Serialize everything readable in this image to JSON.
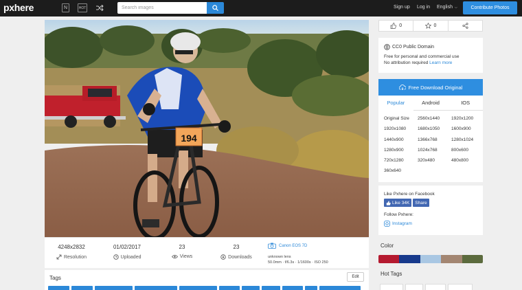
{
  "header": {
    "logo": "pxhere",
    "icon_new": "N",
    "icon_hot": "HOT",
    "search_placeholder": "Search images",
    "signup": "Sign up",
    "login": "Log in",
    "language": "English",
    "contribute": "Contribute Photos"
  },
  "stats": {
    "resolution_value": "4248x2832",
    "resolution_label": "Resolution",
    "uploaded_value": "01/02/2017",
    "uploaded_label": "Uploaded",
    "views_value": "23",
    "views_label": "Views",
    "downloads_value": "23",
    "downloads_label": "Downloads",
    "camera": "Canon EOS 7D",
    "lens": "unknown lens",
    "exif": "50.0mm · f/6.3s · 1/1600s · ISO 250"
  },
  "tags": {
    "title": "Tags",
    "edit": "Edit"
  },
  "sidebar": {
    "likes": "0",
    "favorites": "0",
    "license_title": "CC0 Public Domain",
    "license_line1": "Free for personal and commercial use",
    "license_line2": "No attribution required",
    "learn_more": "Learn more",
    "download_button": "Free Download Original",
    "tabs": [
      "Popular",
      "Android",
      "IOS"
    ],
    "sizes": [
      "Original Size",
      "2560x1440",
      "1920x1200",
      "1920x1080",
      "1680x1050",
      "1600x900",
      "1440x900",
      "1366x768",
      "1280x1024",
      "1280x900",
      "1024x768",
      "800x600",
      "720x1280",
      "320x480",
      "480x800",
      "360x640"
    ],
    "facebook_title": "Like Pxhere on Facebook",
    "fb_like": "Like 34K",
    "fb_share": "Share",
    "follow": "Follow Pxhere:",
    "instagram": "Instagram",
    "color_title": "Color",
    "colors": [
      "#b51a30",
      "#183a8c",
      "#a9c7e3",
      "#a38672",
      "#5c6b3e"
    ],
    "hot_tags_title": "Hot Tags"
  },
  "photo": {
    "bib_number": "194"
  }
}
